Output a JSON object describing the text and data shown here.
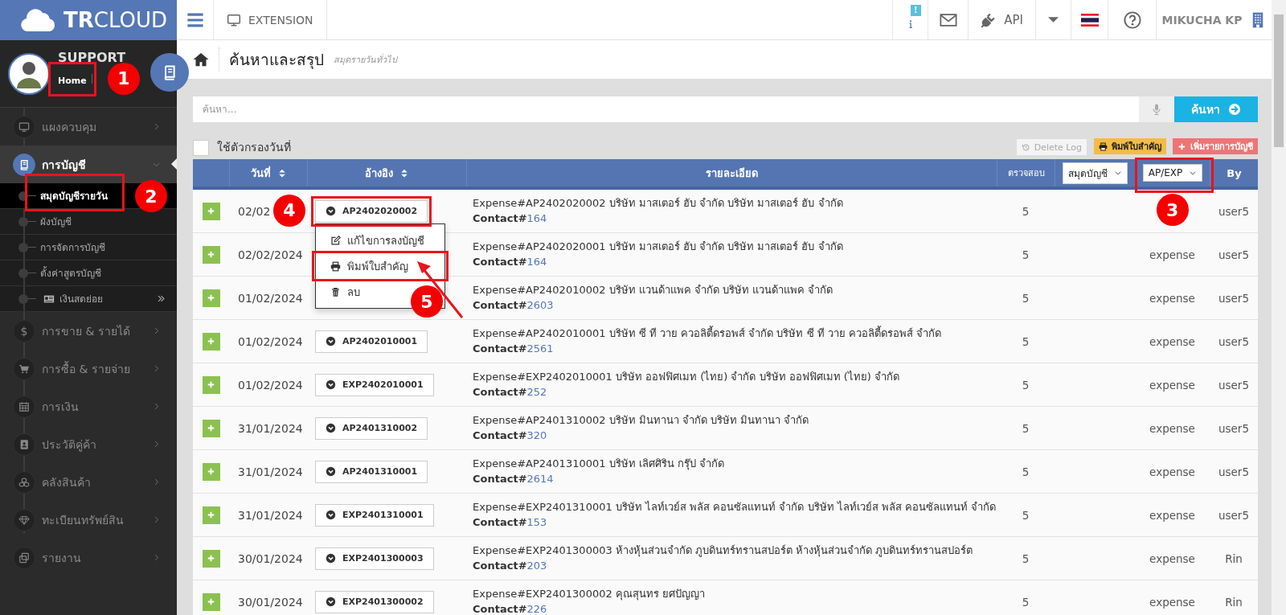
{
  "header": {
    "logo": "**TR**CLOUD",
    "extension": "EXTENSION",
    "notice_badge": "!",
    "api": "API",
    "user": "MIKUCHA KP"
  },
  "sidebar": {
    "profile_name": "SUPPORT",
    "profile_link": "Home",
    "profile_marker": "1",
    "items": [
      {
        "label": "แผงควบคุม",
        "expanded": false,
        "selected": false
      },
      {
        "label": "การบัญชี",
        "expanded": true,
        "selected": true,
        "children": [
          {
            "label": "สมุดบัญชีรายวัน",
            "selected": true,
            "has_submenu": false,
            "marker": "2"
          },
          {
            "label": "ผังบัญชี",
            "selected": false,
            "has_submenu": false
          },
          {
            "label": "การจัดการบัญชี",
            "selected": false,
            "has_submenu": false
          },
          {
            "label": "ตั้งค่าสูตรบัญชี",
            "selected": false,
            "has_submenu": false
          },
          {
            "label": "เงินสดย่อย",
            "selected": false,
            "has_submenu": true
          }
        ]
      },
      {
        "label": "การขาย & รายได้",
        "icon_text": "$",
        "expanded": false,
        "selected": false
      },
      {
        "label": "การซื้อ & รายจ่าย",
        "expanded": false,
        "selected": false
      },
      {
        "label": "การเงิน",
        "expanded": false,
        "selected": false
      },
      {
        "label": "ประวัติคู่ค้า",
        "expanded": false,
        "selected": false
      },
      {
        "label": "คลังสินค้า",
        "expanded": false,
        "selected": false
      },
      {
        "label": "ทะเบียนทรัพย์สิน",
        "expanded": false,
        "selected": false
      },
      {
        "label": "รายงาน",
        "expanded": false,
        "selected": false
      }
    ]
  },
  "page": {
    "title": "ค้นหาและสรุป",
    "subtitle": "สมุดรายวันทั่วไป"
  },
  "search": {
    "placeholder": "ค้นหา...",
    "button": "ค้นหา"
  },
  "date_filter": {
    "label": "ใช้ตัวกรองวันที่",
    "checked": false
  },
  "actions": [
    {
      "label": "Delete Log",
      "kind": "log"
    },
    {
      "label": "พิมพ์ใบสำคัญ",
      "kind": "print"
    },
    {
      "label": "เพิ่มรายการบัญชี",
      "kind": "add"
    }
  ],
  "table": {
    "columns": [
      {
        "label": "วันที่",
        "sortable": true
      },
      {
        "label": "อ้างอิง",
        "sortable": true
      },
      {
        "label": "รายละเอียด",
        "sortable": false
      },
      {
        "label": "ตรวจสอบ",
        "sortable": false
      },
      {
        "label": "By",
        "sortable": false
      }
    ],
    "filters": [
      {
        "label": "สมุดบัญชี"
      },
      {
        "label": "AP/EXP",
        "marker": "3"
      }
    ],
    "rows": [
      {
        "date": "02/02",
        "ref": "AP2402020002",
        "ref_marker": "4",
        "detail": "Expense#AP2402020002 บริษัท มาสเตอร์ ฮับ จำกัด บริษัท มาสเตอร์ ฮับ จำกัด",
        "contact_prefix": "Contact#",
        "contact": "164",
        "check": "5",
        "by": "user5"
      },
      {
        "date": "02/02/2024",
        "detail": "Expense#AP2402020001 บริษัท มาสเตอร์ ฮับ จำกัด บริษัท มาสเตอร์ ฮับ จำกัด",
        "contact_prefix": "Contact#",
        "contact": "164",
        "check": "5",
        "type": "expense",
        "by": "user5"
      },
      {
        "date": "01/02/2024",
        "detail": "Expense#AP2402010002 บริษัท แวนด้าแพค จำกัด บริษัท แวนด้าแพค จำกัด",
        "contact_prefix": "Contact#",
        "contact": "2603",
        "check": "5",
        "type": "expense",
        "by": "user5"
      },
      {
        "date": "01/02/2024",
        "ref": "AP2402010001",
        "detail": "Expense#AP2402010001 บริษัท ซี ที วาย ควอลิตี้ดรอพส์ จำกัด บริษัท ซี ที วาย ควอลิตี้ดรอพส์ จำกัด",
        "contact_prefix": "Contact#",
        "contact": "2561",
        "check": "5",
        "type": "expense",
        "by": "user5"
      },
      {
        "date": "01/02/2024",
        "ref": "EXP2402010001",
        "detail": "Expense#EXP2402010001 บริษัท ออฟฟิศเมท (ไทย) จำกัด บริษัท ออฟฟิศเมท (ไทย) จำกัด",
        "contact_prefix": "Contact#",
        "contact": "252",
        "check": "5",
        "type": "expense",
        "by": "user5"
      },
      {
        "date": "31/01/2024",
        "ref": "AP2401310002",
        "detail": "Expense#AP2401310002 บริษัท มินทานา จำกัด บริษัท มินทานา จำกัด",
        "contact_prefix": "Contact#",
        "contact": "320",
        "check": "5",
        "type": "expense",
        "by": "user5"
      },
      {
        "date": "31/01/2024",
        "ref": "AP2401310001",
        "detail": "Expense#AP2401310001 บริษัท เลิศศิริน กรุ๊ป จำกัด",
        "contact_prefix": "Contact#",
        "contact": "2614",
        "check": "5",
        "type": "expense",
        "by": "user5"
      },
      {
        "date": "31/01/2024",
        "ref": "EXP2401310001",
        "detail": "Expense#EXP2401310001 บริษัท ไลท์เวย์ส พลัส คอนซัลแทนท์ จำกัด บริษัท ไลท์เวย์ส พลัส คอนซัลแทนท์ จำกัด",
        "contact_prefix": "Contact#",
        "contact": "153",
        "check": "5",
        "type": "expense",
        "by": "user5"
      },
      {
        "date": "30/01/2024",
        "ref": "EXP2401300003",
        "detail": "Expense#EXP2401300003 ห้างหุ้นส่วนจำกัด ภูบดินทร์ทรานสปอร์ต ห้างหุ้นส่วนจำกัด ภูบดินทร์ทรานสปอร์ต",
        "contact_prefix": "Contact#",
        "contact": "203",
        "check": "5",
        "type": "expense",
        "by": "Rin"
      },
      {
        "date": "30/01/2024",
        "ref": "EXP2401300002",
        "detail": "Expense#EXP2401300002 คุณสุนทร ยศปัญญา",
        "contact_prefix": "Contact#",
        "contact": "226",
        "check": "5",
        "type": "expense",
        "by": "Rin"
      }
    ]
  },
  "ref_menu": {
    "items": [
      {
        "label": "แก้ไขการลงบัญชี",
        "kind": "edit"
      },
      {
        "label": "พิมพ์ใบสำคัญ",
        "kind": "print",
        "marker": "5",
        "arrow": true
      },
      {
        "label": "ลบ",
        "kind": "delete"
      }
    ]
  }
}
